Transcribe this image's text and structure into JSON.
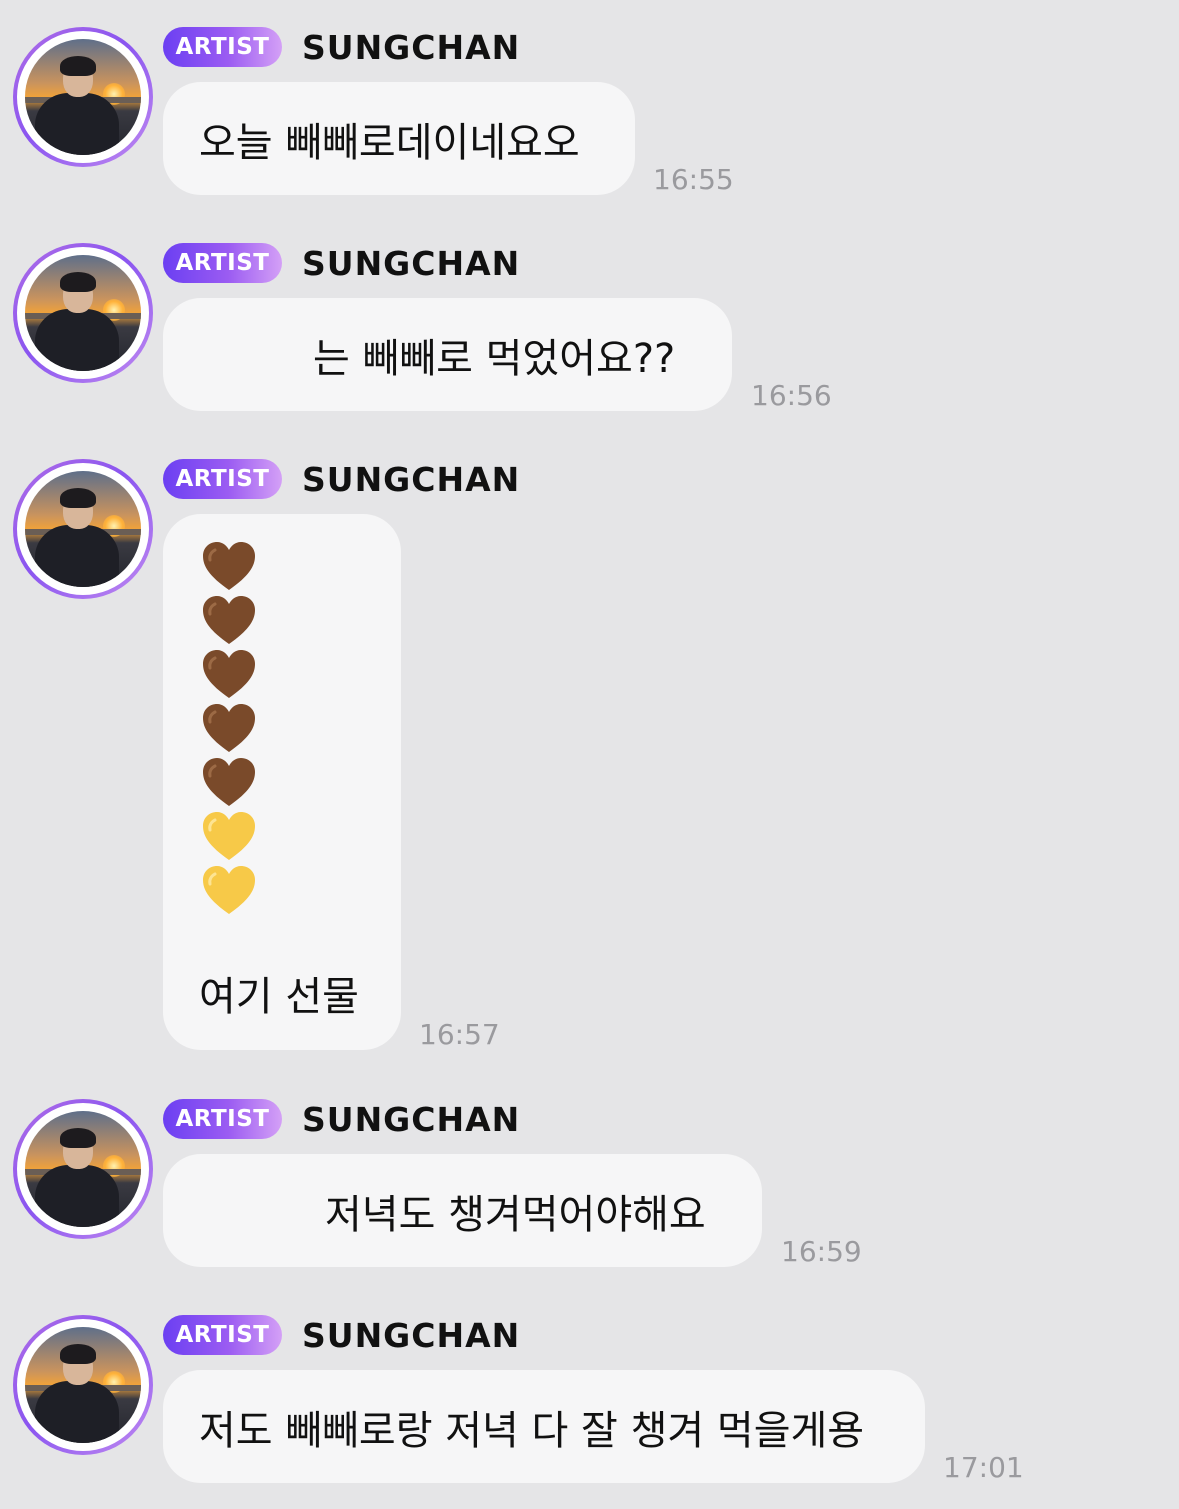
{
  "messages": [
    {
      "badge": "ARTIST",
      "sender": "SUNGCHAN",
      "text": "오늘 빼빼로데이네요오",
      "time": "16:55"
    },
    {
      "badge": "ARTIST",
      "sender": "SUNGCHAN",
      "text": "는 빼빼로 먹었어요??",
      "time": "16:56"
    },
    {
      "badge": "ARTIST",
      "sender": "SUNGCHAN",
      "hearts": [
        "brown-heart",
        "brown-heart",
        "brown-heart",
        "brown-heart",
        "brown-heart",
        "yellow-heart",
        "yellow-heart"
      ],
      "text": "여기 선물",
      "time": "16:57"
    },
    {
      "badge": "ARTIST",
      "sender": "SUNGCHAN",
      "text": "저녁도 챙겨먹어야해요",
      "time": "16:59"
    },
    {
      "badge": "ARTIST",
      "sender": "SUNGCHAN",
      "text": "저도 빼빼로랑 저녁 다 잘 챙겨 먹을게용",
      "time": "17:01"
    }
  ],
  "colors": {
    "background": "#e5e5e7",
    "bubble": "#f6f6f7",
    "badge_start": "#6b3ff2",
    "badge_end": "#d4a0f6",
    "timestamp": "#9a9a9e",
    "brown_heart": "#7a4a2a",
    "yellow_heart": "#f7c948"
  }
}
